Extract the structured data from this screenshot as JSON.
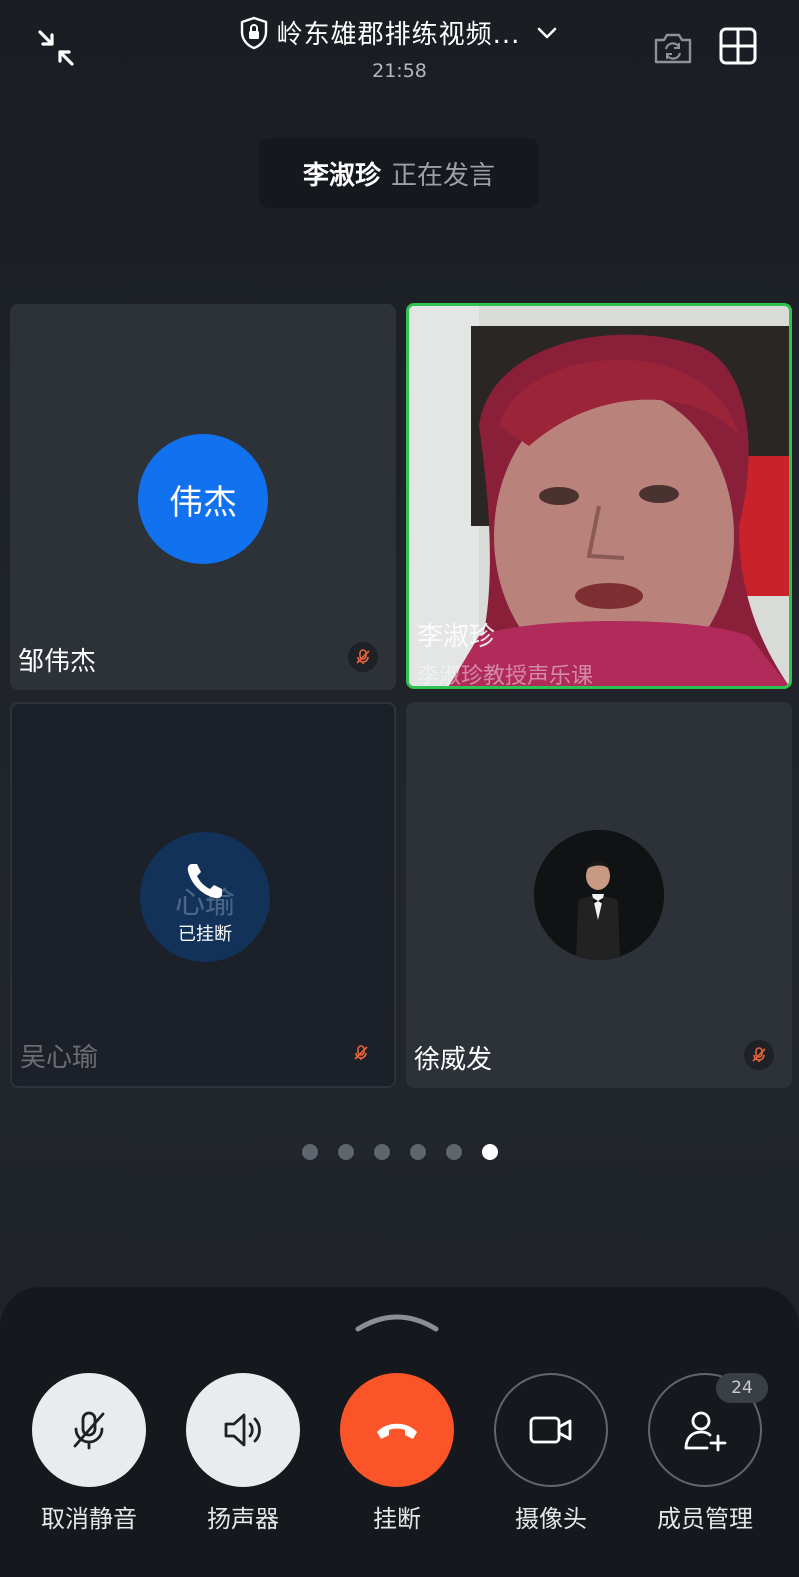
{
  "header": {
    "title": "岭东雄郡排练视频...",
    "time": "21:58"
  },
  "speaking": {
    "name": "李淑珍",
    "label": "正在发言"
  },
  "tiles": [
    {
      "name": "邹伟杰",
      "avatar_text": "伟杰",
      "avatar_color": "#1171ee",
      "muted": true
    },
    {
      "name": "李淑珍",
      "subtitle": "李淑珍教授声乐课",
      "video": true,
      "active_speaker": true,
      "border_color": "#2ec24f"
    },
    {
      "name": "吴心瑜",
      "avatar_text": "心瑜",
      "status": "已挂断",
      "muted": true
    },
    {
      "name": "徐威发",
      "avatar": "photo",
      "muted": true
    }
  ],
  "pagination": {
    "total": 6,
    "current": 6
  },
  "controls": [
    {
      "label": "取消静音",
      "icon": "mic-off-icon"
    },
    {
      "label": "扬声器",
      "icon": "speaker-icon"
    },
    {
      "label": "挂断",
      "icon": "hangup-icon",
      "color": "#fb5428"
    },
    {
      "label": "摄像头",
      "icon": "camera-icon"
    },
    {
      "label": "成员管理",
      "icon": "add-member-icon",
      "badge": "24"
    }
  ]
}
